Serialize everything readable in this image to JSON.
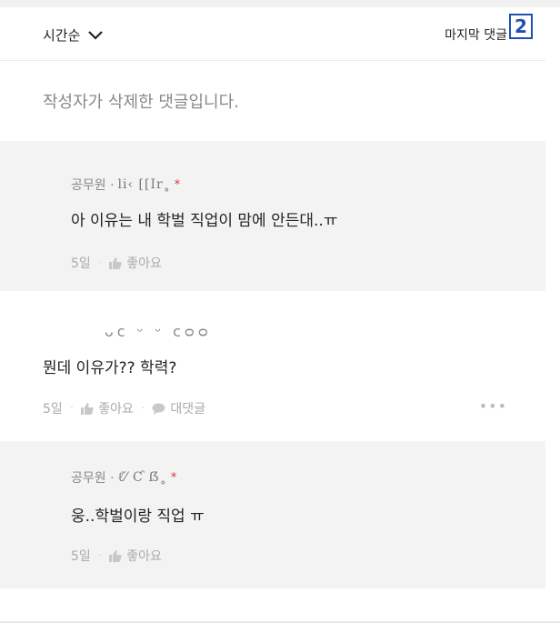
{
  "sort": {
    "label": "시간순"
  },
  "last_comment_link": "마지막 댓글",
  "badge": "2",
  "deleted_comment": "작성자가 삭제한 댓글입니다.",
  "replies": [
    {
      "author_label": "공무원 ·",
      "author_scribble": "li‹ [[Ir˳",
      "star": "*",
      "body": "아 이유는 내 학벌 직업이 맘에 안든대..ㅠ",
      "time": "5일",
      "like_label": "좋아요"
    },
    {
      "author_label": "공무원 ·",
      "author_scribble": "ℓ⁄̌ Ƈ ẞ˳",
      "star": "*",
      "body": "웅..학벌이랑 직업 ㅠ",
      "time": "5일",
      "like_label": "좋아요"
    }
  ],
  "comment": {
    "author_scribble": "ᴗᴄ ᵕ ᵕ ᴄᴑᴑ",
    "body": "뭔데 이유가?? 학력?",
    "time": "5일",
    "like_label": "좋아요",
    "reply_label": "대댓글",
    "more": "•••"
  },
  "colors": {
    "accent_badge": "#1e4fb5",
    "star": "#dd3333",
    "reply_bg": "#f3f3f3"
  },
  "icons": [
    "chevron-down-icon",
    "thumbs-up-icon",
    "speech-bubble-icon",
    "more-icon"
  ]
}
